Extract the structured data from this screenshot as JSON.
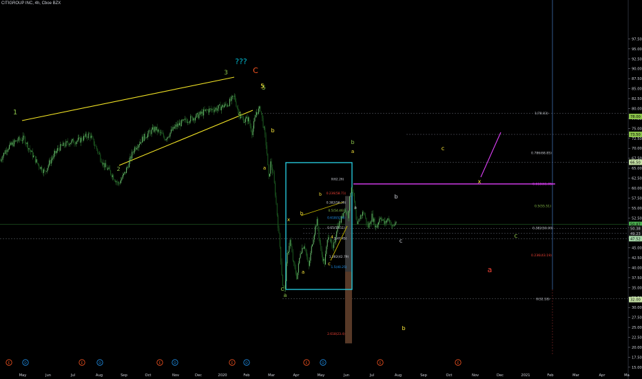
{
  "header": {
    "title": "CITIGROUP INC, 4h, Cboe BZX"
  },
  "chart_data": {
    "type": "candlestick",
    "y_axis": {
      "ticks": [
        97.5,
        95.0,
        92.5,
        90.0,
        87.5,
        85.0,
        82.5,
        80.0,
        77.5,
        75.0,
        72.5,
        70.0,
        67.5,
        65.0,
        62.5,
        60.0,
        57.5,
        55.0,
        52.5,
        50.0,
        47.5,
        45.0,
        42.5,
        40.0,
        37.5,
        35.0,
        32.5,
        30.0,
        27.5,
        25.0,
        22.5,
        20.0,
        17.5,
        15.0
      ],
      "tick_labels": [
        "97.50",
        "95.00",
        "92.50",
        "90.00",
        "87.50",
        "85.00",
        "82.50",
        "80.00",
        "77.50",
        "75.00",
        "72.50",
        "70.00",
        "67.50",
        "65.00",
        "62.50",
        "60.00",
        "57.50",
        "55.00",
        "52.50",
        "50.00",
        "47.50",
        "45.00",
        "42.50",
        "40.00",
        "37.50",
        "35.00",
        "32.50",
        "30.00",
        "27.50",
        "25.00",
        "22.50",
        "20.00",
        "17.50",
        "15.00"
      ],
      "ylim": [
        12.5,
        100
      ]
    },
    "x_axis": {
      "tick_labels": [
        "May",
        "Jun",
        "Jul",
        "Aug",
        "Sep",
        "Oct",
        "Nov",
        "Dec",
        "2020",
        "Feb",
        "Mar",
        "Apr",
        "May",
        "Jun",
        "Jul",
        "Aug",
        "Sep",
        "Oct",
        "Nov",
        "Dec",
        "2021",
        "Feb",
        "Mar",
        "Apr",
        "Ma"
      ]
    },
    "price_badges": [
      {
        "label": "78.00",
        "value": 78.0,
        "color": "#8bc34a",
        "text": "#000"
      },
      {
        "label": "73.50",
        "value": 73.5,
        "color": "#8bc34a",
        "text": "#000"
      },
      {
        "label": "66.50",
        "value": 66.5,
        "color": "#c5e1a5",
        "text": "#000"
      },
      {
        "label": "50.87",
        "value": 50.87,
        "color": "#4caf50",
        "text": "#000"
      },
      {
        "label": "50.38",
        "value": 49.9,
        "color": "#111",
        "text": "#d1d4dc"
      },
      {
        "label": "49.23",
        "value": 48.6,
        "color": "#111",
        "text": "#d1d4dc"
      },
      {
        "label": "47.52",
        "value": 47.3,
        "color": "#a5d6a7",
        "text": "#000"
      },
      {
        "label": "32.00",
        "value": 32.0,
        "color": "#c5e1a5",
        "text": "#000"
      }
    ],
    "fib_right": [
      {
        "label": "1(78.83)",
        "value": 78.83,
        "color": "#d1d4dc"
      },
      {
        "label": "0.786(68.85)",
        "value": 68.85,
        "color": "#d1d4dc"
      },
      {
        "label": "0.618(61.05)",
        "value": 61.05,
        "color": "#e040fb"
      },
      {
        "label": "0.5(55.51)",
        "value": 55.51,
        "color": "#8bc34a"
      },
      {
        "label": "0.382(50.00)",
        "value": 50.0,
        "color": "#d1d4dc"
      },
      {
        "label": "0.236(43.19)",
        "value": 43.19,
        "color": "#f44336"
      },
      {
        "label": "0(32.18)",
        "value": 32.18,
        "color": "#d1d4dc"
      }
    ],
    "fib_box": [
      {
        "label": "0(62.26)",
        "value": 62.26,
        "color": "#d1d4dc"
      },
      {
        "label": "0.236(58.71)",
        "value": 58.71,
        "color": "#f44336"
      },
      {
        "label": "0.382(56.39)",
        "value": 56.39,
        "color": "#d1d4dc"
      },
      {
        "label": "0.5(54.46)",
        "value": 54.46,
        "color": "#8bc34a"
      },
      {
        "label": "0.618(52.6)",
        "value": 52.6,
        "color": "#2196f3"
      },
      {
        "label": "0.65(50.11)",
        "value": 50.11,
        "color": "#d1d4dc"
      },
      {
        "label": "1(47.45)",
        "value": 47.45,
        "color": "#d1d4dc"
      },
      {
        "label": "1.382(42.79)",
        "value": 42.79,
        "color": "#d1d4dc"
      },
      {
        "label": "1.5(40.25)",
        "value": 40.25,
        "color": "#2196f3"
      },
      {
        "label": "2.618(23.4)",
        "value": 23.4,
        "color": "#f44336"
      }
    ],
    "wave_labels": [
      {
        "text": "1",
        "color": "#8bc34a"
      },
      {
        "text": "2",
        "color": "#8bc34a"
      },
      {
        "text": "3",
        "color": "#8bc34a"
      },
      {
        "text": "???",
        "color": "#00bcd4"
      },
      {
        "text": "C",
        "color": "#ff5722"
      },
      {
        "text": "5",
        "color": "#8bc34a"
      },
      {
        "text": "4",
        "color": "#8bc34a"
      },
      {
        "text": "b",
        "color": "#ffeb3b"
      },
      {
        "text": "a",
        "color": "#ffeb3b"
      },
      {
        "text": "c",
        "color": "#8bc34a"
      },
      {
        "text": "a",
        "color": "#8bc34a"
      },
      {
        "text": "x",
        "color": "#ffeb3b"
      },
      {
        "text": "b",
        "color": "#ffeb3b"
      },
      {
        "text": "a",
        "color": "#ffeb3b"
      },
      {
        "text": "c",
        "color": "#ffeb3b"
      },
      {
        "text": "b",
        "color": "#8bc34a"
      },
      {
        "text": "a",
        "color": "#ffeb3b"
      },
      {
        "text": "a",
        "color": "#d1d4dc"
      },
      {
        "text": "b",
        "color": "#d1d4dc"
      },
      {
        "text": "c",
        "color": "#d1d4dc"
      },
      {
        "text": "c",
        "color": "#ffeb3b"
      },
      {
        "text": "x",
        "color": "#ffeb3b"
      },
      {
        "text": "c",
        "color": "#8bc34a"
      },
      {
        "text": "a",
        "color": "#f44336"
      },
      {
        "text": "b",
        "color": "#ffeb3b"
      },
      {
        "text": "b",
        "color": "#ffeb3b"
      },
      {
        "text": "4",
        "color": "#ffeb3b"
      },
      {
        "text": "5",
        "color": "#ffeb3b"
      }
    ],
    "event_markers": [
      "E",
      "D",
      "E",
      "D",
      "E",
      "D",
      "E",
      "D",
      "E",
      "D",
      "E",
      "E"
    ]
  }
}
